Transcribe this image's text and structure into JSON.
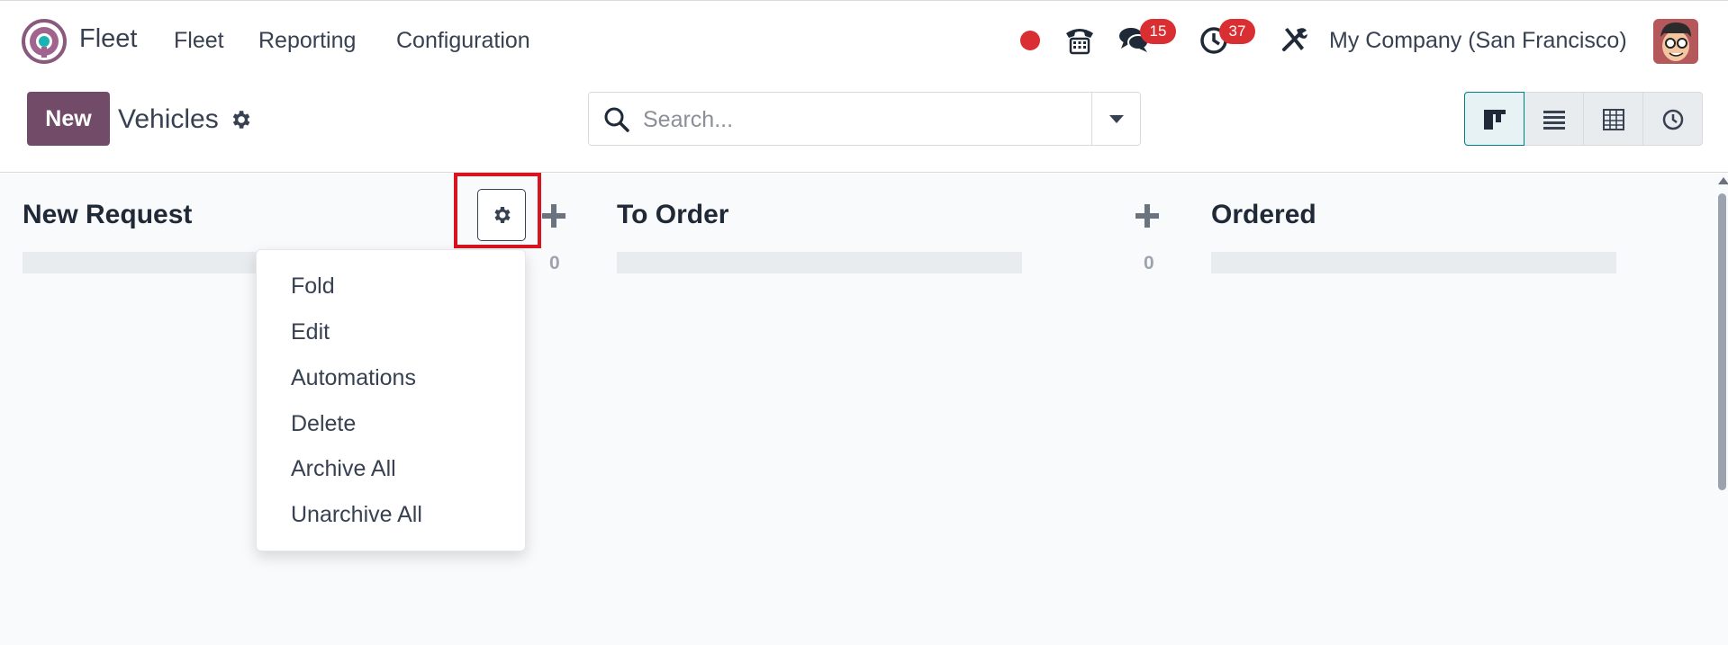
{
  "navbar": {
    "app_name": "Fleet",
    "menus": [
      "Fleet",
      "Reporting",
      "Configuration"
    ],
    "messages_count": "15",
    "activities_count": "37",
    "company": "My Company (San Francisco)"
  },
  "control_panel": {
    "new_label": "New",
    "breadcrumb": "Vehicles",
    "search_placeholder": "Search..."
  },
  "kanban": {
    "columns": [
      {
        "title": "New Request",
        "count": "0"
      },
      {
        "title": "To Order",
        "count": "0"
      },
      {
        "title": "Ordered",
        "count": ""
      }
    ],
    "column_menu": [
      "Fold",
      "Edit",
      "Automations",
      "Delete",
      "Archive All",
      "Unarchive All"
    ]
  },
  "colors": {
    "brand": "#714b67",
    "badge": "#d92f33",
    "highlight": "#d7141f",
    "active_view": "#017e84"
  },
  "icons": [
    "steering-wheel-icon",
    "phone-icon",
    "chat-icon",
    "clock-icon",
    "tools-icon",
    "gear-icon",
    "search-icon",
    "kanban-view-icon",
    "list-view-icon",
    "pivot-view-icon",
    "activity-view-icon",
    "plus-icon"
  ]
}
